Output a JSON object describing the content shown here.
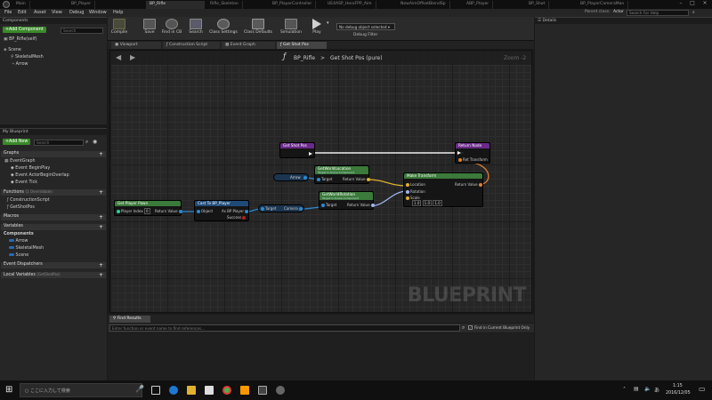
{
  "window": {
    "tabs": [
      "Main",
      "BP_Player",
      "BP_Rifle",
      "Rifle_Skeleton",
      "BP_PlayerController",
      "UE4ASP_HeroFPP_Aim",
      "NewAimOffsetBlendSp",
      "ABP_Player",
      "BP_Shot",
      "BP_PlayerCameraMan"
    ],
    "active_tab": "BP_Rifle",
    "parent_class_label": "Parent class:",
    "parent_class_value": "Actor"
  },
  "menu": [
    "File",
    "Edit",
    "Asset",
    "View",
    "Debug",
    "Window",
    "Help"
  ],
  "toolbar": {
    "compile": "Compile",
    "save": "Save",
    "find_in_cb": "Find in CB",
    "search": "Search",
    "class_settings": "Class Settings",
    "class_defaults": "Class Defaults",
    "simulation": "Simulation",
    "play": "Play",
    "debug_select": "No debug object selected",
    "debug_filter": "Debug Filter",
    "search_help": "Search For Help"
  },
  "components": {
    "header": "Components",
    "add_button": "+Add Component",
    "self_item": "BP_Rifle(self)",
    "search_placeholder": "Search",
    "tree": [
      "Scene",
      "SkeletalMesh",
      "Arrow"
    ]
  },
  "my_blueprint": {
    "header": "My Blueprint",
    "add_button": "+Add New",
    "search_placeholder": "Search",
    "graphs_label": "Graphs",
    "event_graph": "EventGraph",
    "events": [
      "Event BeginPlay",
      "Event ActorBeginOverlap",
      "Event Tick"
    ],
    "functions_label": "Functions",
    "functions_note": "(1 Overridable)",
    "functions": [
      "ConstructionScript",
      "GetShotPos"
    ],
    "macros_label": "Macros",
    "variables_label": "Variables",
    "components_label": "Components",
    "components": [
      "Arrow",
      "SkeletalMesh",
      "Scene"
    ],
    "event_dispatchers_label": "Event Dispatchers",
    "local_variables_label": "Local Variables",
    "local_variables_note": "(GetShotPos)"
  },
  "graph_tabs": [
    "Viewport",
    "Construction Script",
    "Event Graph",
    "Get Shot Pos"
  ],
  "active_graph_tab": "Get Shot Pos",
  "graph": {
    "breadcrumb_root": "BP_Rifle",
    "breadcrumb_sep": ">",
    "breadcrumb_func": "Get Shot Pos (pure)",
    "zoom": "Zoom -2",
    "watermark": "BLUEPRINT",
    "nodes": {
      "get_shot_pos": {
        "title": "Get Shot Pos"
      },
      "return_node": {
        "title": "Return Node",
        "pin": "Ret Transform"
      },
      "arrow_var": {
        "title": "Arrow"
      },
      "get_world_location": {
        "title": "GetWorldLocation",
        "sub": "Target is Scene Component",
        "pin_in": "Target",
        "pin_out": "Return Value"
      },
      "get_world_rotation": {
        "title": "GetWorldRotation",
        "sub": "Target is Scene Component",
        "pin_in": "Target",
        "pin_out": "Return Value"
      },
      "make_transform": {
        "title": "Make Transform",
        "pins": [
          "Location",
          "Rotation",
          "Scale"
        ],
        "pin_out": "Return Value",
        "scale_values": [
          "1.0",
          "1.0",
          "1.0"
        ]
      },
      "get_player_pawn": {
        "title": "Get Player Pawn",
        "pin_in": "Player Index",
        "pin_in_value": "0",
        "pin_out": "Return Value"
      },
      "cast_to_bp_player": {
        "title": "Cast To BP_Player",
        "pin_in": "Object",
        "pin_out": "As BP Player",
        "pin_success": "Success"
      },
      "camera_get": {
        "pin_in": "Target",
        "pin_out": "Camera"
      }
    }
  },
  "find_results": {
    "header": "Find Results",
    "placeholder": "Enter function or event name to find references...",
    "checkbox_label": "Find in Current Blueprint Only"
  },
  "details": {
    "header": "Details"
  },
  "taskbar": {
    "search_placeholder": "ここに入力して検索",
    "time": "1:15",
    "date": "2016/12/05"
  },
  "colors": {
    "accent_green": "#3a8a2a",
    "pure_node": "#3b7a3a",
    "function_node": "#6a2a8a",
    "cast_node": "#1f4a78",
    "var_node": "#2a6bb0"
  }
}
